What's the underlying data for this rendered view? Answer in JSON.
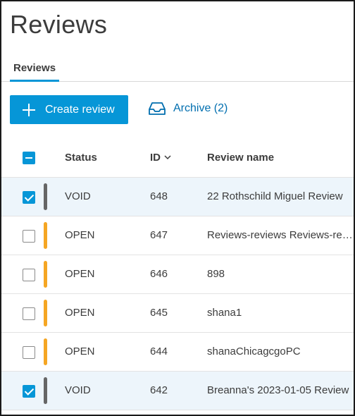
{
  "page": {
    "title": "Reviews"
  },
  "tabs": [
    {
      "label": "Reviews",
      "active": true
    }
  ],
  "toolbar": {
    "create_label": "Create review",
    "archive_label": "Archive (2)"
  },
  "table": {
    "headers": {
      "status": "Status",
      "id": "ID",
      "name": "Review name"
    },
    "rows": [
      {
        "selected": true,
        "status": "VOID",
        "id": "648",
        "name": "22 Rothschild Miguel Review"
      },
      {
        "selected": false,
        "status": "OPEN",
        "id": "647",
        "name": "Reviews-reviews Reviews-reviews"
      },
      {
        "selected": false,
        "status": "OPEN",
        "id": "646",
        "name": "898"
      },
      {
        "selected": false,
        "status": "OPEN",
        "id": "645",
        "name": "shana1"
      },
      {
        "selected": false,
        "status": "OPEN",
        "id": "644",
        "name": "shanaChicagcgoPC"
      },
      {
        "selected": true,
        "status": "VOID",
        "id": "642",
        "name": "Breanna's 2023-01-05 Review"
      }
    ]
  },
  "colors": {
    "accent": "#0696d7",
    "link": "#006eaf",
    "status_void": "#666666",
    "status_open": "#f5a623",
    "selected_row": "#edf5fb"
  }
}
